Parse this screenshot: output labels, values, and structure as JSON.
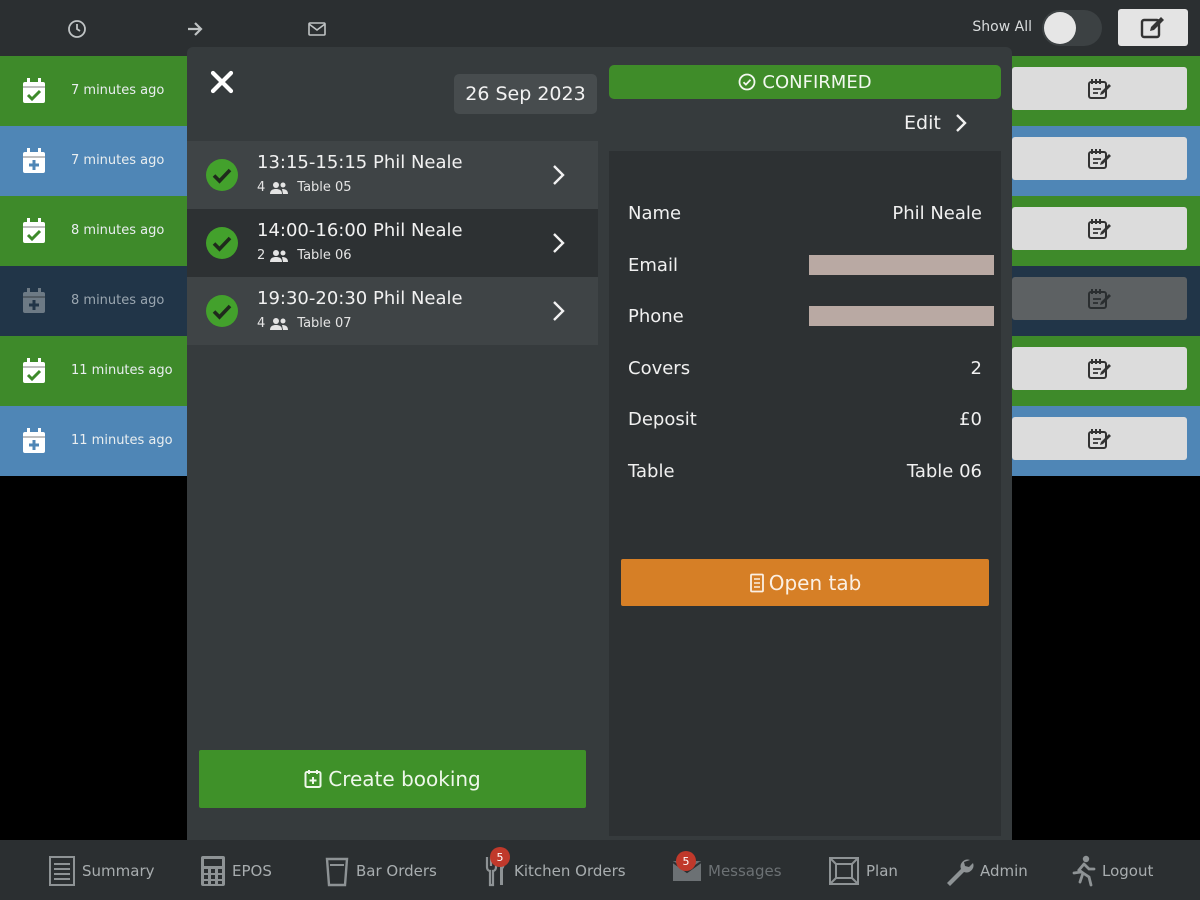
{
  "topbar": {
    "icons": [
      "clock-icon",
      "arrow-right-icon",
      "envelope-icon"
    ],
    "show_all_label": "Show All",
    "show_all_on": false
  },
  "background_rows": [
    {
      "time": "7 minutes ago",
      "icon": "calendar-check-icon",
      "color": "#3e8a2a"
    },
    {
      "time": "7 minutes ago",
      "icon": "calendar-plus-icon",
      "color": "#4f86b6"
    },
    {
      "time": "8 minutes ago",
      "icon": "calendar-check-icon",
      "color": "#3e8a2a"
    },
    {
      "time": "8 minutes ago",
      "icon": "calendar-plus-icon",
      "color": "#213548"
    },
    {
      "time": "11 minutes ago",
      "icon": "calendar-check-icon",
      "color": "#3e8a2a"
    },
    {
      "time": "11 minutes ago",
      "icon": "calendar-plus-icon",
      "color": "#4f86b6"
    }
  ],
  "modal": {
    "date": "26 Sep 2023",
    "bookings": [
      {
        "title": "13:15-15:15 Phil Neale",
        "covers": "4",
        "table": "Table 05"
      },
      {
        "title": "14:00-16:00 Phil Neale",
        "covers": "2",
        "table": "Table 06"
      },
      {
        "title": "19:30-20:30 Phil Neale",
        "covers": "4",
        "table": "Table 07"
      }
    ],
    "create_booking_label": "Create booking",
    "status": "CONFIRMED",
    "edit_label": "Edit",
    "details": {
      "name_label": "Name",
      "name_value": "Phil Neale",
      "email_label": "Email",
      "phone_label": "Phone",
      "covers_label": "Covers",
      "covers_value": "2",
      "deposit_label": "Deposit",
      "deposit_value": "£0",
      "table_label": "Table",
      "table_value": "Table 06"
    },
    "open_tab_label": "Open tab"
  },
  "bottom_nav": [
    {
      "label": "Summary",
      "icon": "list-icon"
    },
    {
      "label": "EPOS",
      "icon": "calculator-icon"
    },
    {
      "label": "Bar Orders",
      "icon": "glass-icon"
    },
    {
      "label": "Kitchen Orders",
      "icon": "cutlery-icon",
      "badge": "5"
    },
    {
      "label": "Messages",
      "icon": "envelope-icon",
      "badge": "5"
    },
    {
      "label": "Plan",
      "icon": "floor-plan-icon"
    },
    {
      "label": "Admin",
      "icon": "wrench-icon"
    },
    {
      "label": "Logout",
      "icon": "running-man-icon"
    }
  ],
  "colors": {
    "confirmed_green": "#3f8c29",
    "create_green": "#3f9129",
    "open_tab_orange": "#d67f26",
    "badge_red": "#c0392b"
  }
}
